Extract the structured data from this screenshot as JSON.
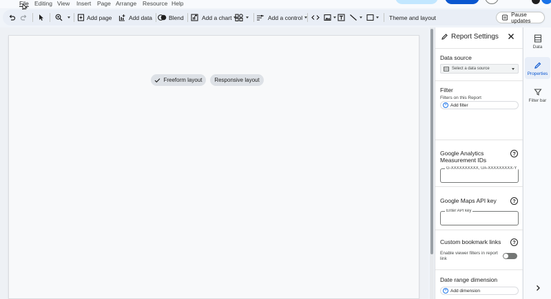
{
  "menubar": {
    "items": [
      "File",
      "Editing",
      "View",
      "Insert",
      "Page",
      "Arrange",
      "Resource",
      "Help"
    ],
    "active": "File"
  },
  "toolbar": {
    "add_page": "Add page",
    "add_data": "Add data",
    "blend": "Blend",
    "add_chart": "Add a chart",
    "add_control": "Add a control",
    "theme_layout": "Theme and layout",
    "pause_updates": "Pause updates"
  },
  "canvas": {
    "freeform_layout": "Freeform layout",
    "responsive_layout": "Responsive layout",
    "selected_layout": "Freeform layout"
  },
  "panel": {
    "title": "Report Settings",
    "data_source": {
      "label": "Data source",
      "placeholder": "Select a data source"
    },
    "filter": {
      "label": "Filter",
      "sublabel": "Filters on this Report",
      "add_label": "Add filter"
    },
    "ga": {
      "label_line1": "Google Analytics",
      "label_line2": "Measurement IDs",
      "placeholder": "G-XXXXXXXXXX, UA-XXXXXXXXX-Y"
    },
    "maps": {
      "label": "Google Maps API key",
      "placeholder": "Enter API key"
    },
    "bookmark": {
      "label": "Custom bookmark links",
      "toggle_label_line1": "Enable viewer filters in report",
      "toggle_label_line2": "link",
      "enabled": false
    },
    "date_range": {
      "label": "Date range dimension",
      "add_label": "Add dimension"
    }
  },
  "rail": {
    "data": "Data",
    "properties": "Properties",
    "filter_bar": "Filter bar",
    "active": "Properties"
  },
  "colors": {
    "accent_blue": "#0b57d0",
    "light_blue": "#c2e7ff",
    "toolbar_bg": "#e9eef6"
  }
}
